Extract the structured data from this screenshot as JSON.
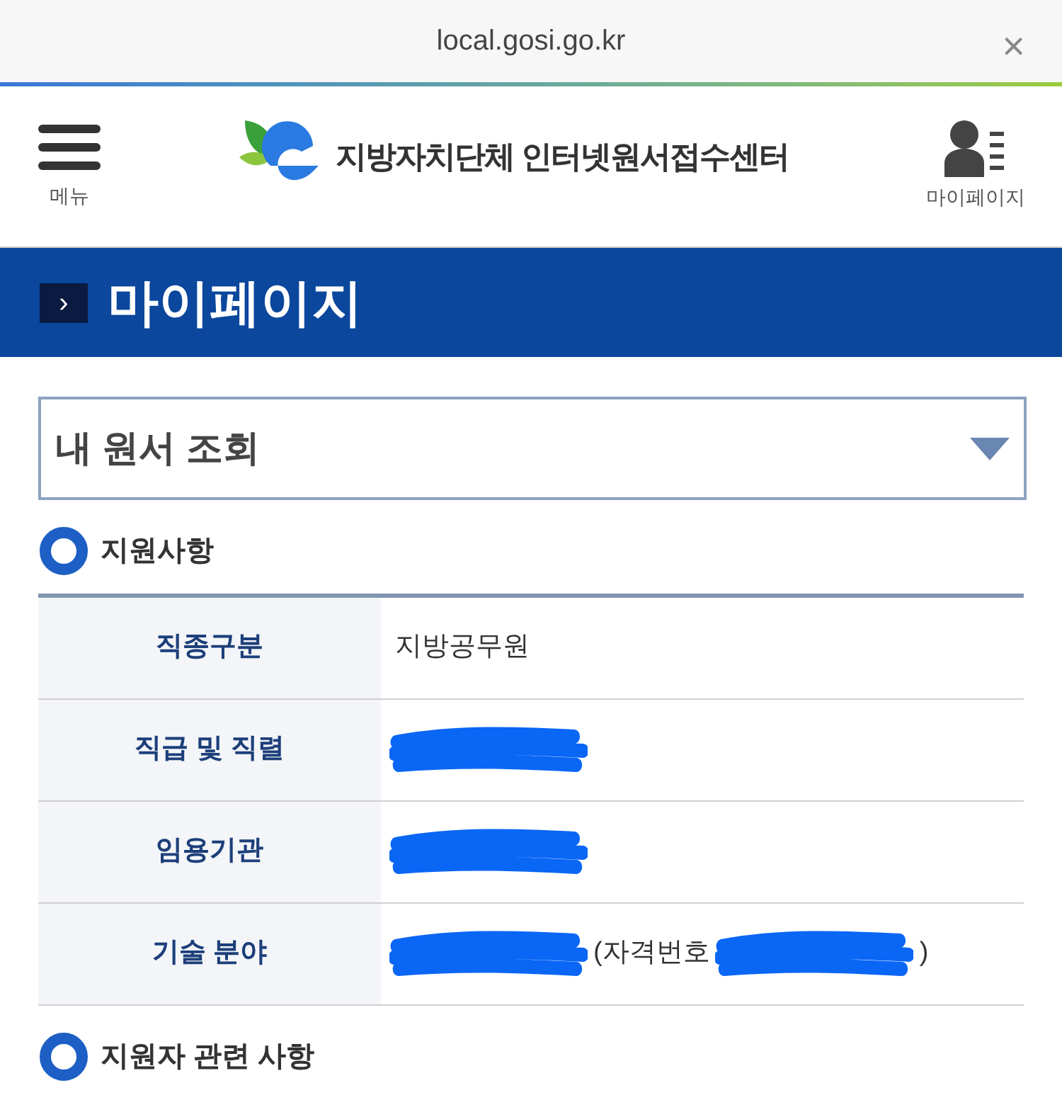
{
  "browser": {
    "url": "local.gosi.go.kr",
    "close": "×"
  },
  "header": {
    "menu_label": "메뉴",
    "site_title": "지방자치단체 인터넷원서접수센터",
    "mypage_label": "마이페이지"
  },
  "banner": {
    "arrow": "›",
    "title": "마이페이지"
  },
  "select": {
    "value": "내 원서 조회"
  },
  "sections": [
    {
      "title": "지원사항",
      "rows": [
        {
          "label": "직종구분",
          "value": [
            {
              "kind": "text",
              "text": "지방공무원"
            }
          ]
        },
        {
          "label": "직급 및 직렬",
          "value": [
            {
              "kind": "redaction"
            }
          ]
        },
        {
          "label": "임용기관",
          "value": [
            {
              "kind": "redaction"
            }
          ]
        },
        {
          "label": "기술 분야",
          "value": [
            {
              "kind": "redaction"
            },
            {
              "kind": "text",
              "text": "(자격번호"
            },
            {
              "kind": "redaction"
            },
            {
              "kind": "text",
              "text": ")"
            }
          ]
        }
      ]
    },
    {
      "title": "지원자 관련 사항"
    }
  ]
}
